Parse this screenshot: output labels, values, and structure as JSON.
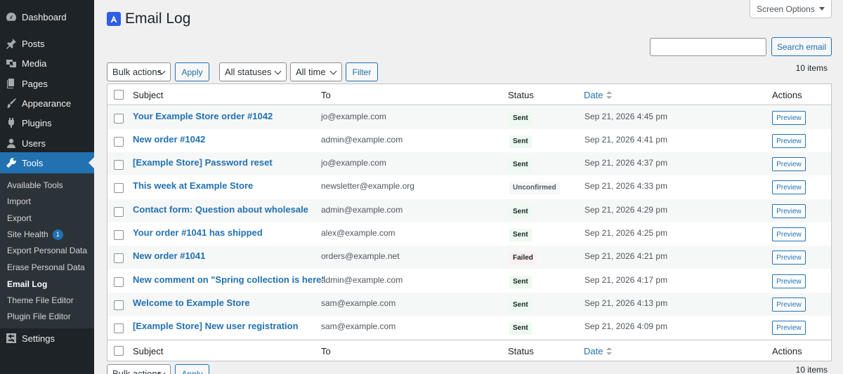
{
  "sidebar": {
    "top_items": [
      {
        "label": "Dashboard",
        "icon": "dashboard-icon"
      },
      {
        "label": "Posts",
        "icon": "pin-icon"
      },
      {
        "label": "Media",
        "icon": "media-icon"
      },
      {
        "label": "Pages",
        "icon": "pages-icon"
      },
      {
        "label": "Appearance",
        "icon": "brush-icon"
      },
      {
        "label": "Plugins",
        "icon": "plugin-icon"
      },
      {
        "label": "Users",
        "icon": "user-icon"
      },
      {
        "label": "Tools",
        "icon": "wrench-icon"
      },
      {
        "label": "Settings",
        "icon": "settings-icon"
      }
    ],
    "tools_submenu": [
      {
        "label": "Available Tools"
      },
      {
        "label": "Import"
      },
      {
        "label": "Export"
      },
      {
        "label": "Site Health",
        "badge": "1"
      },
      {
        "label": "Export Personal Data"
      },
      {
        "label": "Erase Personal Data"
      },
      {
        "label": "Email Log"
      },
      {
        "label": "Theme File Editor"
      },
      {
        "label": "Plugin File Editor"
      }
    ]
  },
  "header": {
    "screen_options": "Screen Options",
    "title": "Email Log"
  },
  "search": {
    "value": "",
    "button": "Search email"
  },
  "toolbar": {
    "bulk_actions": "Bulk actions",
    "apply": "Apply",
    "status_filter": "All statuses",
    "time_filter": "All time",
    "filter": "Filter",
    "items_count": "10 items"
  },
  "table": {
    "columns": {
      "subject": "Subject",
      "to": "To",
      "status": "Status",
      "date": "Date",
      "actions": "Actions"
    },
    "rows": [
      {
        "subject": "Your Example Store order #1042",
        "to": "jo@example.com",
        "status": "Sent",
        "date": "Sep 21, 2026 4:45 pm",
        "action": "Preview"
      },
      {
        "subject": "New order #1042",
        "to": "admin@example.com",
        "status": "Sent",
        "date": "Sep 21, 2026 4:41 pm",
        "action": "Preview"
      },
      {
        "subject": "[Example Store] Password reset",
        "to": "jo@example.com",
        "status": "Sent",
        "date": "Sep 21, 2026 4:37 pm",
        "action": "Preview"
      },
      {
        "subject": "This week at Example Store",
        "to": "newsletter@example.org",
        "status": "Unconfirmed",
        "date": "Sep 21, 2026 4:33 pm",
        "action": "Preview"
      },
      {
        "subject": "Contact form: Question about wholesale",
        "to": "admin@example.com",
        "status": "Sent",
        "date": "Sep 21, 2026 4:29 pm",
        "action": "Preview"
      },
      {
        "subject": "Your order #1041 has shipped",
        "to": "alex@example.com",
        "status": "Sent",
        "date": "Sep 21, 2026 4:25 pm",
        "action": "Preview"
      },
      {
        "subject": "New order #1041",
        "to": "orders@example.net",
        "status": "Failed",
        "date": "Sep 21, 2026 4:21 pm",
        "action": "Preview"
      },
      {
        "subject": "New comment on \"Spring collection is here\"",
        "to": "admin@example.com",
        "status": "Sent",
        "date": "Sep 21, 2026 4:17 pm",
        "action": "Preview"
      },
      {
        "subject": "Welcome to Example Store",
        "to": "sam@example.com",
        "status": "Sent",
        "date": "Sep 21, 2026 4:13 pm",
        "action": "Preview"
      },
      {
        "subject": "[Example Store] New user registration",
        "to": "sam@example.com",
        "status": "Sent",
        "date": "Sep 21, 2026 4:09 pm",
        "action": "Preview"
      }
    ]
  },
  "colors": {
    "accent": "#2271b1",
    "sidebar_bg": "#1d2327",
    "sent_bg": "#edfaef",
    "failed_bg": "#fcf0f1"
  }
}
